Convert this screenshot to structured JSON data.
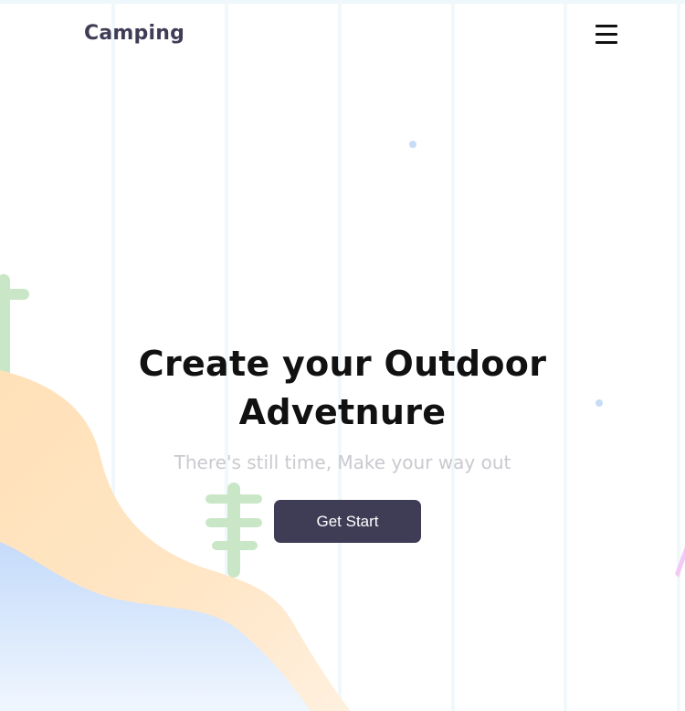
{
  "header": {
    "brand": "Camping",
    "menu_icon": "hamburger-menu-icon"
  },
  "hero": {
    "title_line1": "Create your Outdoor",
    "title_line2": "Advetnure",
    "subtitle": "There's still time, Make your way out",
    "cta_label": "Get Start"
  },
  "colors": {
    "brand_text": "#3f3d56",
    "button_bg": "#3f3d56",
    "button_text": "#ffffff",
    "subtitle_text": "#c9c9cf",
    "hill_orange": "#ffe2bd",
    "hill_blue": "#cfe2fb",
    "cactus_green": "#c9e7c6",
    "dot_blue": "#c6dcf7",
    "accent_pink": "#f3c9f5"
  },
  "decorations": {
    "cactus_icon": "cactus-icon",
    "hill_shape": "hill-shape",
    "tent_icon": "tent-icon"
  }
}
